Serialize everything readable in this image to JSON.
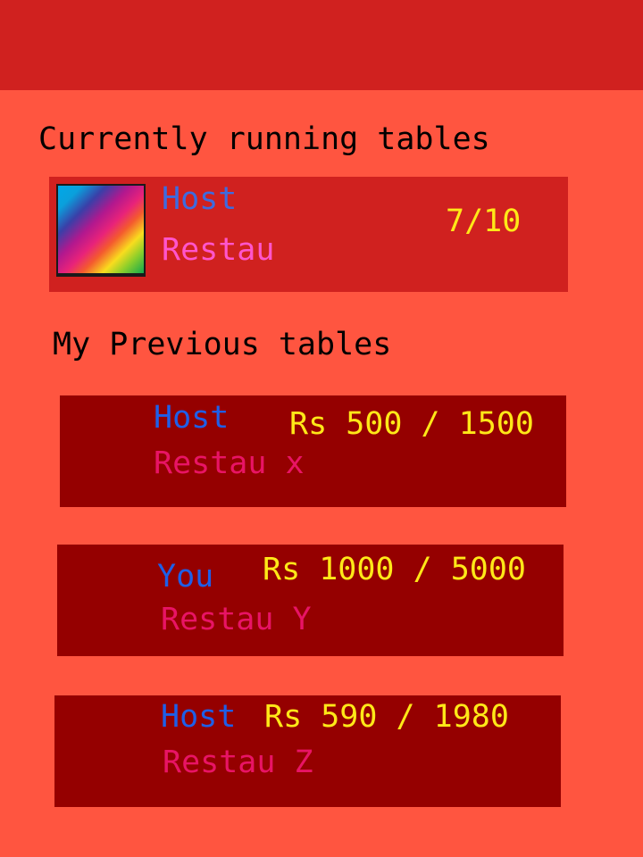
{
  "current_section": {
    "title": "Currently running tables",
    "tables": [
      {
        "host": "Host",
        "restaurant": "Restau",
        "occupancy": "7/10",
        "thumbnail": "rainbow-gradient-image"
      }
    ]
  },
  "previous_section": {
    "title": "My Previous tables",
    "tables": [
      {
        "who": "Host",
        "restaurant": "Restau x",
        "amount": "Rs 500 / 1500"
      },
      {
        "who": "You",
        "restaurant": "Restau Y",
        "amount": "Rs 1000 / 5000"
      },
      {
        "who": "Host",
        "restaurant": "Restau Z",
        "amount": "Rs 590 / 1980"
      }
    ]
  },
  "colors": {
    "app_bar": "#D0211F",
    "background": "#FF5540",
    "current_card": "#D0211F",
    "previous_card": "#950000",
    "amount_text": "#FFE818",
    "host_text_current": "#3D6BE0",
    "restaurant_text_current": "#FF55CC",
    "who_text_previous": "#1E5FE8",
    "restaurant_text_previous": "#E81465"
  }
}
